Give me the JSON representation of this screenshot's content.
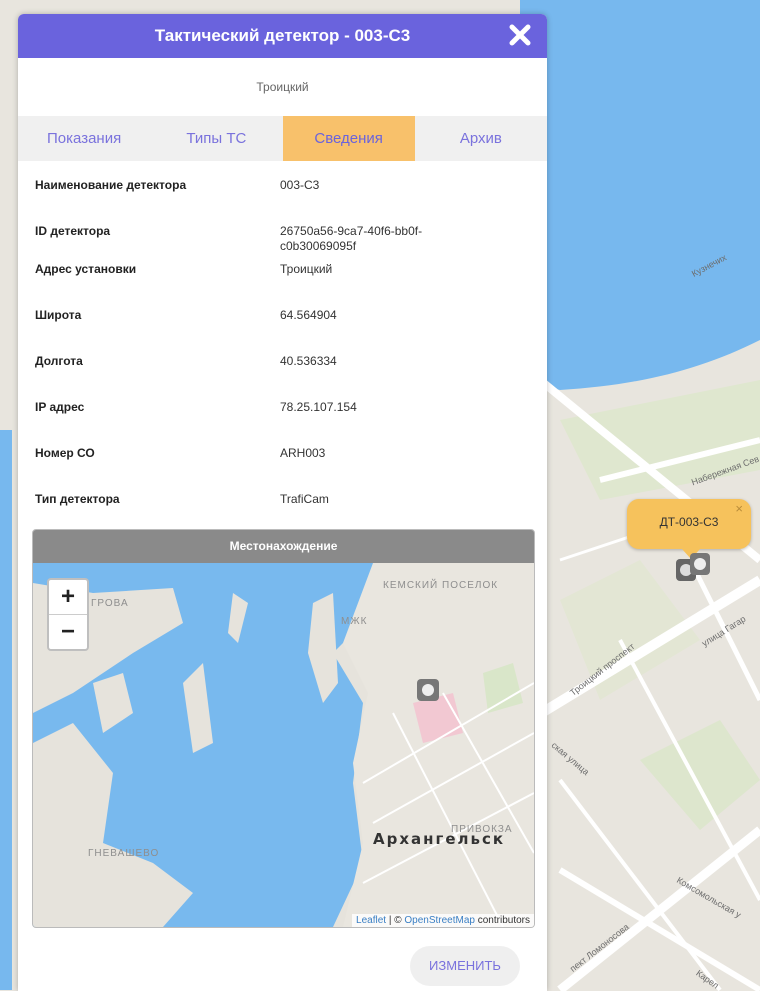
{
  "background_map": {
    "popup_label": "ДТ-003-С3",
    "streets": [
      "Кузнечих",
      "Набережная Сев",
      "улица Гагар",
      "Троицкий проспект",
      "ская улица",
      "Комсомольская у",
      "пект Ломоносова",
      "Карел"
    ]
  },
  "panel": {
    "title": "Тактический детектор - 003-С3",
    "subtitle": "Троицкий",
    "tabs": [
      {
        "label": "Показания",
        "active": false
      },
      {
        "label": "Типы ТС",
        "active": false
      },
      {
        "label": "Сведения",
        "active": true
      },
      {
        "label": "Архив",
        "active": false
      }
    ],
    "info": [
      {
        "key": "Наименование детектора",
        "value": "003-С3"
      },
      {
        "key": "ID детектора",
        "value": "26750a56-9ca7-40f6-bb0f-c0b30069095f"
      },
      {
        "key": "Адрес установки",
        "value": "Троицкий"
      },
      {
        "key": "Широта",
        "value": "64.564904"
      },
      {
        "key": "Долгота",
        "value": "40.536334"
      },
      {
        "key": "IP адрес",
        "value": "78.25.107.154"
      },
      {
        "key": "Номер СО",
        "value": "ARH003"
      },
      {
        "key": "Тип детектора",
        "value": "TrafiCam"
      }
    ],
    "map": {
      "header": "Местонахождение",
      "zoom_in": "+",
      "zoom_out": "−",
      "city": "Архангельск",
      "labels": [
        "КЕМСКИЙ ПОСЕЛОК",
        "МЖК",
        "ПРИВОКЗА",
        "ГНЕВАШЕВО",
        "ГРОВА"
      ],
      "attribution": {
        "leaflet": "Leaflet",
        "sep": " | © ",
        "osm": "OpenStreetMap",
        "tail": " contributors"
      }
    },
    "edit_button": "ИЗМЕНИТЬ"
  },
  "colors": {
    "header": "#6a63dd",
    "active_tab": "#f8c16b",
    "water": "#76b9ee",
    "land": "#e9e6df"
  }
}
